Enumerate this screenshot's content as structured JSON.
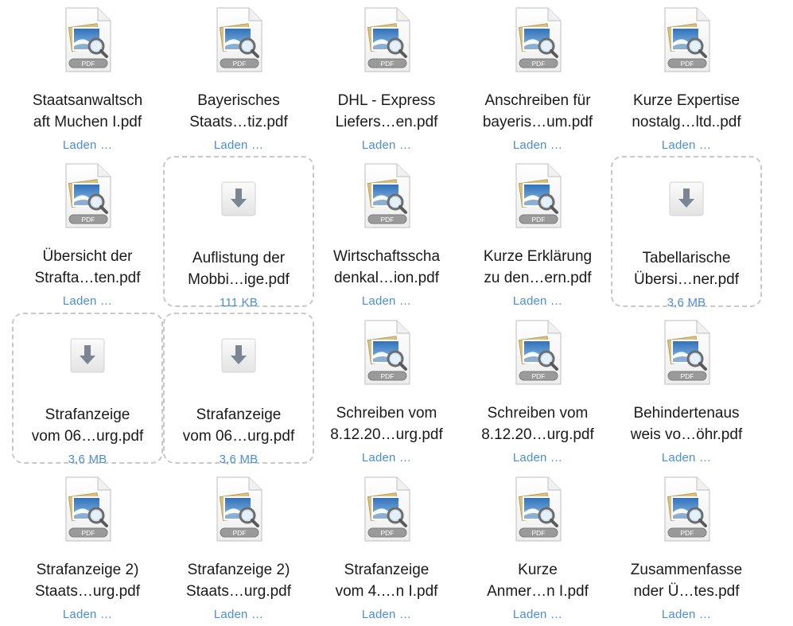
{
  "files": [
    {
      "line1": "Staatsanwaltsch",
      "line2": "aft Muchen I.pdf",
      "status": "Laden …",
      "kind": "pdf",
      "pdf_label": "PDF"
    },
    {
      "line1": "Bayerisches",
      "line2": "Staats…tiz.pdf",
      "status": "Laden …",
      "kind": "pdf",
      "pdf_label": "PDF"
    },
    {
      "line1": "DHL - Express",
      "line2": "Liefers…en.pdf",
      "status": "Laden …",
      "kind": "pdf",
      "pdf_label": "PDF"
    },
    {
      "line1": "Anschreiben für",
      "line2": "bayeris…um.pdf",
      "status": "Laden …",
      "kind": "pdf",
      "pdf_label": "PDF"
    },
    {
      "line1": "Kurze Expertise",
      "line2": "nostalg…ltd..pdf",
      "status": "Laden …",
      "kind": "pdf",
      "pdf_label": "PDF"
    },
    {
      "line1": "Übersicht der",
      "line2": "Strafta…ten.pdf",
      "status": "Laden …",
      "kind": "pdf",
      "pdf_label": "PDF"
    },
    {
      "line1": "Auflistung der",
      "line2": "Mobbi…ige.pdf",
      "status": "111 KB",
      "kind": "download"
    },
    {
      "line1": "Wirtschaftsscha",
      "line2": "denkal…ion.pdf",
      "status": "Laden …",
      "kind": "pdf",
      "pdf_label": "PDF"
    },
    {
      "line1": "Kurze Erklärung",
      "line2": "zu den…ern.pdf",
      "status": "Laden …",
      "kind": "pdf",
      "pdf_label": "PDF"
    },
    {
      "line1": "Tabellarische",
      "line2": "Übersi…ner.pdf",
      "status": "3,6 MB",
      "kind": "download"
    },
    {
      "line1": "Strafanzeige",
      "line2": "vom 06…urg.pdf",
      "status": "3,6 MB",
      "kind": "download"
    },
    {
      "line1": "Strafanzeige",
      "line2": "vom 06…urg.pdf",
      "status": "3,6 MB",
      "kind": "download"
    },
    {
      "line1": "Schreiben vom",
      "line2": "8.12.20…urg.pdf",
      "status": "Laden …",
      "kind": "pdf",
      "pdf_label": "PDF"
    },
    {
      "line1": "Schreiben vom",
      "line2": "8.12.20…urg.pdf",
      "status": "Laden …",
      "kind": "pdf",
      "pdf_label": "PDF"
    },
    {
      "line1": "Behindertenaus",
      "line2": "weis vo…öhr.pdf",
      "status": "Laden …",
      "kind": "pdf",
      "pdf_label": "PDF"
    },
    {
      "line1": "Strafanzeige 2)",
      "line2": "Staats…urg.pdf",
      "status": "Laden …",
      "kind": "pdf",
      "pdf_label": "PDF"
    },
    {
      "line1": "Strafanzeige 2)",
      "line2": "Staats…urg.pdf",
      "status": "Laden …",
      "kind": "pdf",
      "pdf_label": "PDF"
    },
    {
      "line1": "Strafanzeige",
      "line2": "vom 4.…n I.pdf",
      "status": "Laden …",
      "kind": "pdf",
      "pdf_label": "PDF"
    },
    {
      "line1": "Kurze",
      "line2": "Anmer…n I.pdf",
      "status": "Laden …",
      "kind": "pdf",
      "pdf_label": "PDF"
    },
    {
      "line1": "Zusammenfasse",
      "line2": "nder Ü…tes.pdf",
      "status": "Laden …",
      "kind": "pdf",
      "pdf_label": "PDF"
    }
  ],
  "colors": {
    "status": "#4a8fd6",
    "dashed_border": "#c8c8c8",
    "text": "#1a1a1a"
  },
  "icons": {
    "pdf": "pdf-preview-document-icon",
    "download": "download-arrow-icon"
  }
}
